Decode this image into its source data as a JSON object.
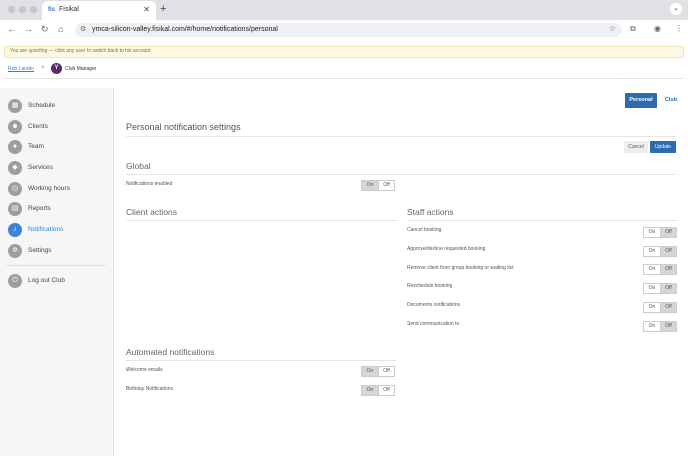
{
  "browser": {
    "tab_title": "Fisikal",
    "tab_favicon": "fis",
    "new_tab_label": "+",
    "url": "ymca-silicon-valley.fisikal.com/#/home/notifications/personal"
  },
  "banner": {
    "spoof_text": "You are spoofing — click any user to switch back to his account"
  },
  "breadcrumb": {
    "user": "Rob Lander",
    "separator": ">",
    "club_logo": "Y",
    "current": "Club Manager"
  },
  "sidebar": {
    "items": [
      {
        "label": "Schedule",
        "icon": "calendar-icon",
        "glyph": "▦"
      },
      {
        "label": "Clients",
        "icon": "users-icon",
        "glyph": "☻"
      },
      {
        "label": "Team",
        "icon": "person-icon",
        "glyph": "●"
      },
      {
        "label": "Services",
        "icon": "services-icon",
        "glyph": "◆"
      },
      {
        "label": "Working hours",
        "icon": "clock-icon",
        "glyph": "◷"
      },
      {
        "label": "Reports",
        "icon": "reports-icon",
        "glyph": "▤"
      },
      {
        "label": "Notifications",
        "icon": "bell-icon",
        "glyph": "♪",
        "active": true
      },
      {
        "label": "Settings",
        "icon": "gear-icon",
        "glyph": "✲"
      }
    ],
    "logout": {
      "label": "Log out Club",
      "icon": "power-icon",
      "glyph": "⏻"
    }
  },
  "segment": {
    "personal": "Personal",
    "club": "Club"
  },
  "main": {
    "title": "Personal notification settings",
    "cancel_label": "Cancel",
    "update_label": "Update"
  },
  "toggle_labels": {
    "on": "On",
    "off": "Off"
  },
  "global": {
    "title": "Global",
    "rows": [
      {
        "label": "Notifications enabled",
        "value": "On"
      }
    ]
  },
  "client_actions": {
    "title": "Client actions"
  },
  "staff_actions": {
    "title": "Staff actions",
    "rows": [
      {
        "label": "Cancel booking",
        "value": "Off"
      },
      {
        "label": "Approve/decline requested booking",
        "value": "Off"
      },
      {
        "label": "Remove client from group booking or waiting list",
        "value": "Off"
      },
      {
        "label": "Reschedule booking",
        "value": "Off"
      },
      {
        "label": "Documents notifications",
        "value": "Off"
      },
      {
        "label": "Send communication to",
        "value": "Off"
      }
    ]
  },
  "automated": {
    "title": "Automated notifications",
    "rows": [
      {
        "label": "Welcome emails",
        "value": "On"
      },
      {
        "label": "Birthday Notifications",
        "value": "On"
      }
    ]
  }
}
